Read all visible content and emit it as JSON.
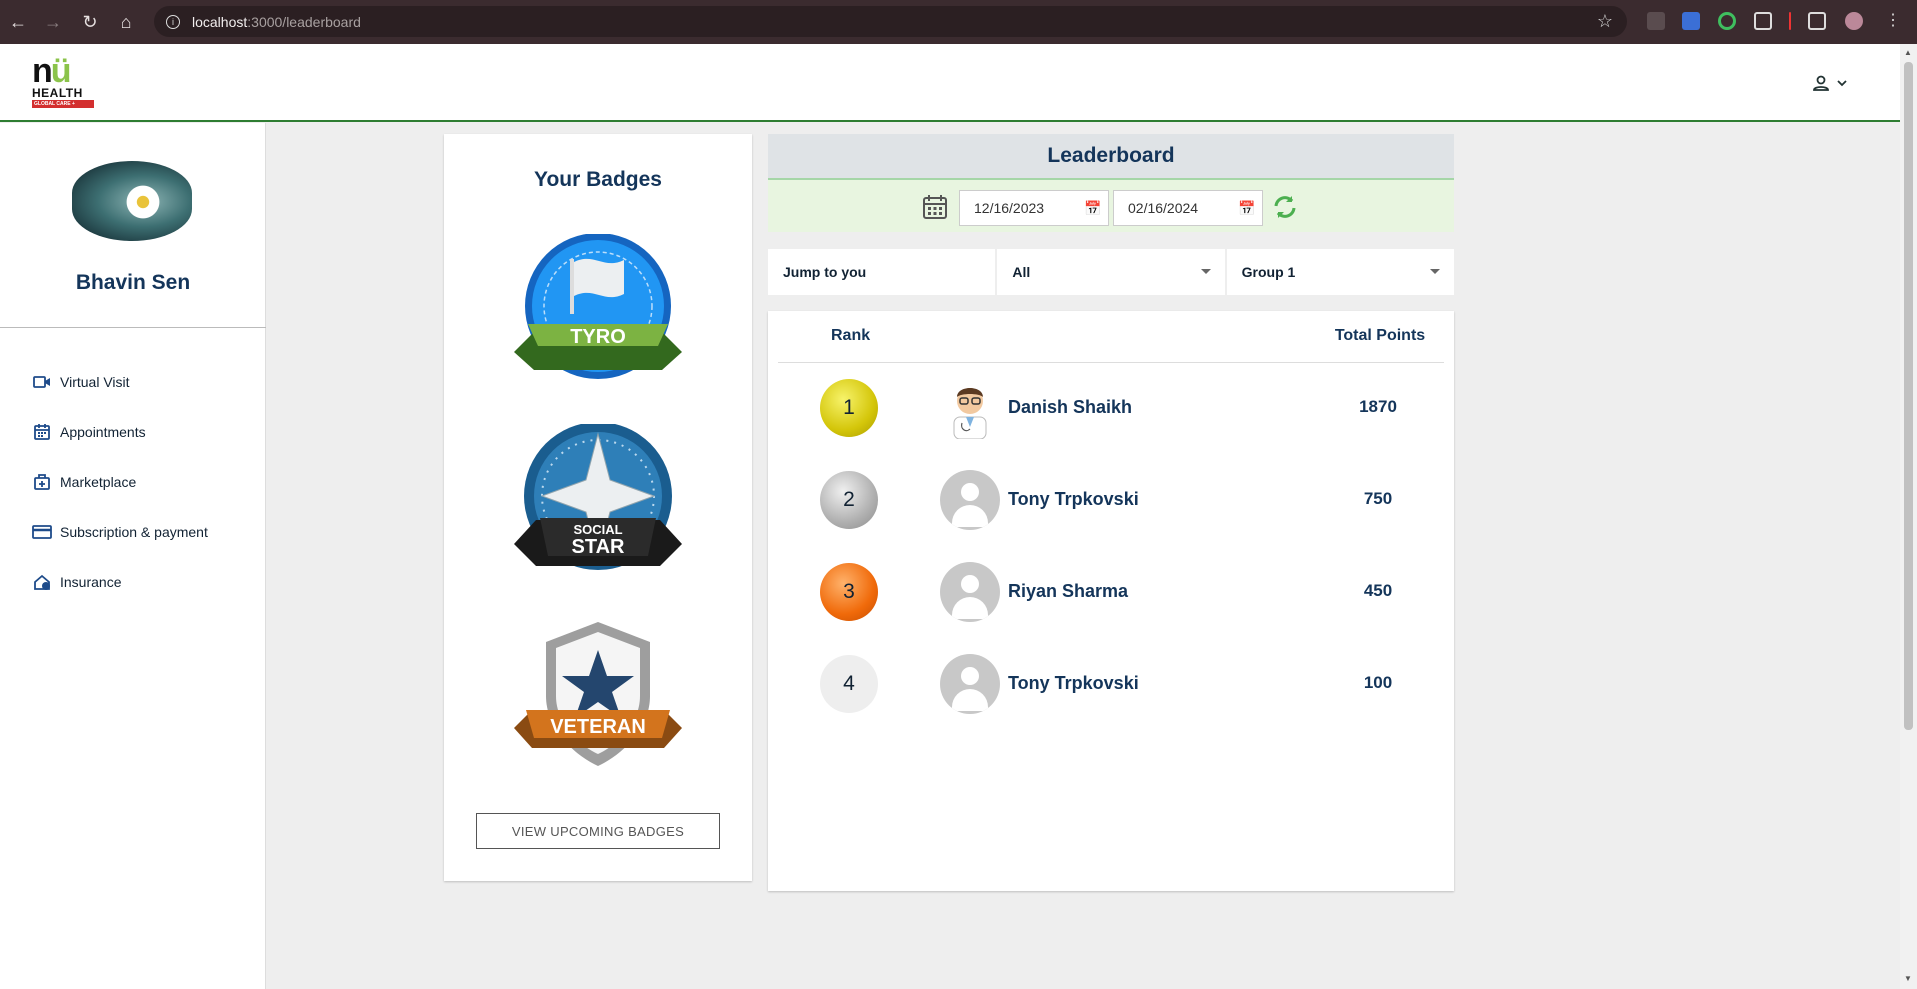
{
  "browser": {
    "url_host": "localhost",
    "url_path": ":3000/leaderboard"
  },
  "logo": {
    "top": "NIU",
    "health": "HEALTH",
    "tagline": "GLOBAL CARE +"
  },
  "sidebar": {
    "username": "Bhavin Sen",
    "items": [
      {
        "label": "Virtual Visit",
        "icon": "video-icon"
      },
      {
        "label": "Appointments",
        "icon": "calendar-icon"
      },
      {
        "label": "Marketplace",
        "icon": "medical-bag-icon"
      },
      {
        "label": "Subscription & payment",
        "icon": "credit-card-icon"
      },
      {
        "label": "Insurance",
        "icon": "home-shield-icon"
      }
    ]
  },
  "badges": {
    "title": "Your Badges",
    "items": [
      {
        "label": "TYRO"
      },
      {
        "label_top": "SOCIAL",
        "label": "STAR"
      },
      {
        "label": "VETERAN"
      }
    ],
    "view_button": "VIEW UPCOMING BADGES"
  },
  "leaderboard": {
    "title": "Leaderboard",
    "start_date": "12/16/2023",
    "end_date": "02/16/2024",
    "filters": {
      "jump": "Jump to you",
      "scope": "All",
      "group": "Group 1"
    },
    "columns": {
      "rank": "Rank",
      "points": "Total Points"
    },
    "rows": [
      {
        "rank": "1",
        "name": "Danish Shaikh",
        "points": "1870",
        "medal": "gold",
        "avatar": "doctor"
      },
      {
        "rank": "2",
        "name": "Tony Trpkovski",
        "points": "750",
        "medal": "silver",
        "avatar": "default"
      },
      {
        "rank": "3",
        "name": "Riyan Sharma",
        "points": "450",
        "medal": "bronze",
        "avatar": "default"
      },
      {
        "rank": "4",
        "name": "Tony Trpkovski",
        "points": "100",
        "medal": "none",
        "avatar": "default"
      }
    ]
  },
  "colors": {
    "primary": "#14355a",
    "accent_green": "#2e7d32",
    "date_bar": "#e8f5e0",
    "header_gray": "#dfe3e6"
  }
}
